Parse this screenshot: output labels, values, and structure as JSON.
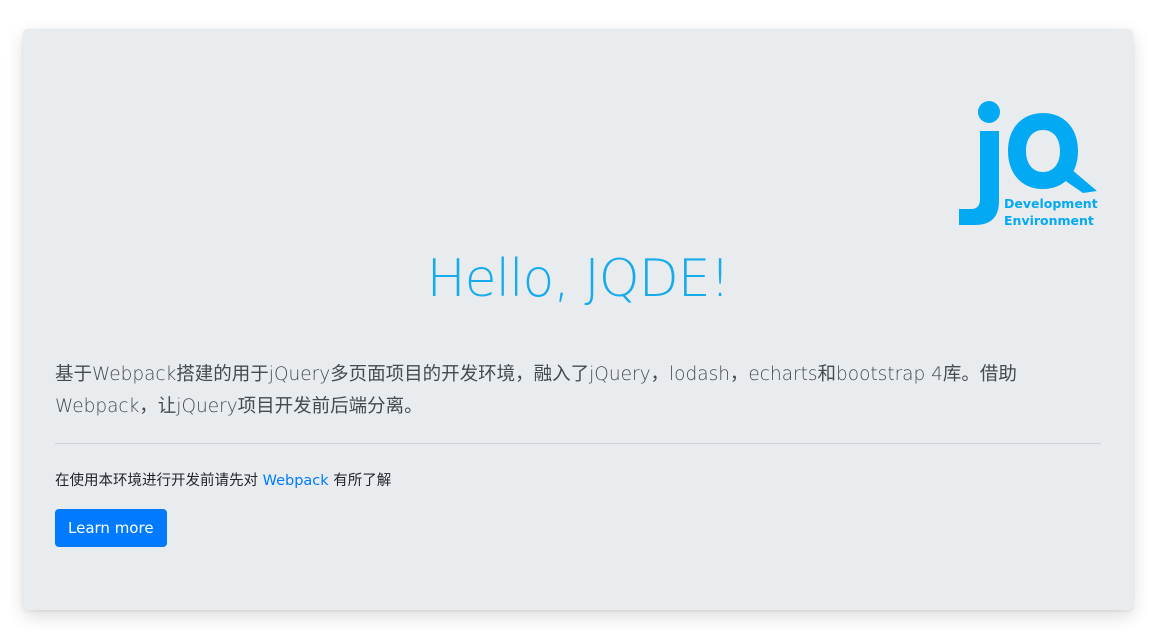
{
  "logo": {
    "mark": "jQ",
    "line1": "Development",
    "line2": "Environment",
    "color": "#04a9f4"
  },
  "heading": "Hello, JQDE!",
  "lead": "基于Webpack搭建的用于jQuery多页面项目的开发环境，融入了jQuery，lodash，echarts和bootstrap 4库。借助Webpack，让jQuery项目开发前后端分离。",
  "note": {
    "before": "在使用本环境进行开发前请先对 ",
    "link": "Webpack",
    "after": " 有所了解"
  },
  "button": {
    "label": "Learn more",
    "color": "#007bff"
  },
  "colors": {
    "background": "#e9ecef",
    "heading": "#16abea",
    "text": "#444a50",
    "link": "#007bff"
  }
}
